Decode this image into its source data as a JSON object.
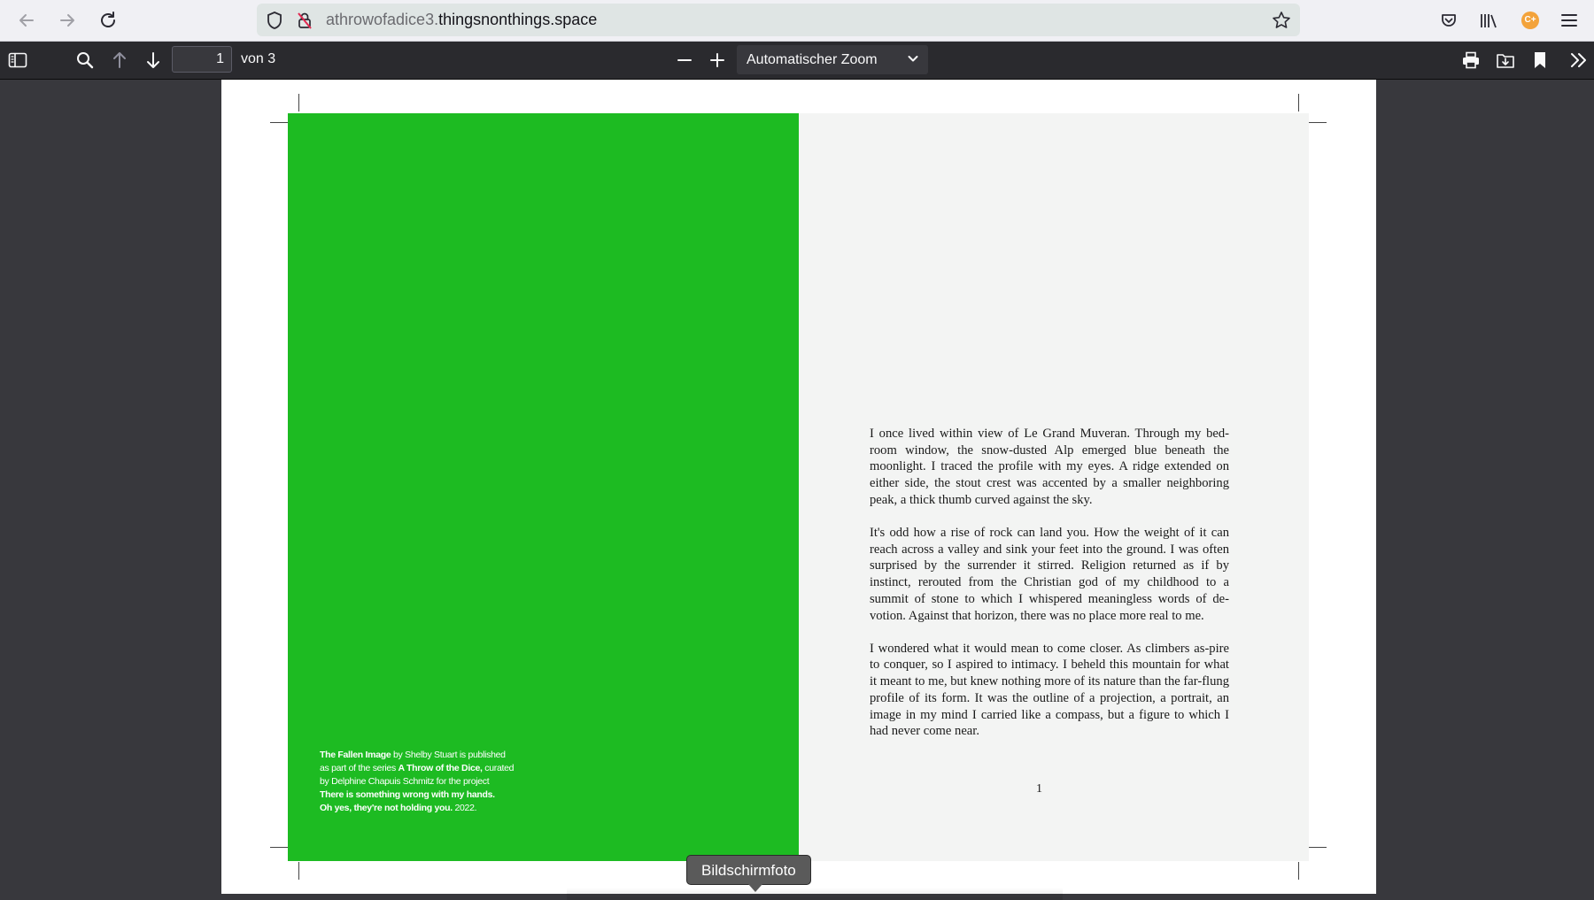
{
  "browser": {
    "url_prefix": "athrowofadice3.",
    "url_domain": "thingsnonthings.space",
    "icons": [
      "back-arrow-icon",
      "forward-arrow-icon",
      "reload-icon",
      "shield-icon",
      "no-tracking-lock-icon",
      "star-icon",
      "pocket-icon",
      "library-icon",
      "extension-avatar-icon",
      "menu-icon"
    ],
    "extension_badge": "C+"
  },
  "pdf_toolbar": {
    "page_number": "1",
    "page_count_label": "von 3",
    "zoom_label": "Automatischer Zoom",
    "icons": [
      "sidebar-toggle-icon",
      "find-icon",
      "previous-page-icon",
      "next-page-icon",
      "zoom-out-icon",
      "zoom-in-icon",
      "print-icon",
      "save-icon",
      "bookmark-icon",
      "tools-icon"
    ]
  },
  "document": {
    "colophon_line1_bold": "The Fallen Image",
    "colophon_line1_rest": " by Shelby Stuart is published",
    "colophon_line2_a": "as part of the series ",
    "colophon_line2_bold": "A Throw of the Dice,",
    "colophon_line2_rest": " curated",
    "colophon_line3": "by Delphine Chapuis Schmitz for the project",
    "colophon_line4_bold": "There is something wrong with my hands.",
    "colophon_line5_bold": "Oh yes, they're not holding you.",
    "colophon_line5_rest": " 2022.",
    "paragraphs": [
      "I once lived within view of Le Grand Muveran. Through my bed-room window, the snow-dusted Alp emerged blue beneath the moonlight. I traced the profile with my eyes. A ridge extended on either side, the stout crest was accented by a smaller neighboring peak, a thick thumb curved against the sky.",
      "It's odd how a rise of rock can land you. How the weight of it can reach across a valley and sink your feet into the ground. I was often surprised by the surrender it stirred. Religion returned as if by instinct, rerouted from the Christian god of my childhood to a summit of stone to which I whispered meaningless words of de-votion. Against that horizon, there was no place more real to me.",
      "I wondered what it would mean to come closer. As climbers as-pire to conquer, so I aspired to intimacy. I beheld this mountain for what it meant to me, but knew nothing more of its nature than the far-flung profile of its form. It was the outline of a projection, a portrait, an image in my mind I carried like a compass, but a figure to which I had never come near."
    ],
    "page_number": "1"
  },
  "tooltip": {
    "label": "Bildschirmfoto"
  },
  "colors": {
    "green_panel": "#1dbb22",
    "toolbar_dark": "#2a2a2e",
    "viewer_bg": "#38383d"
  }
}
